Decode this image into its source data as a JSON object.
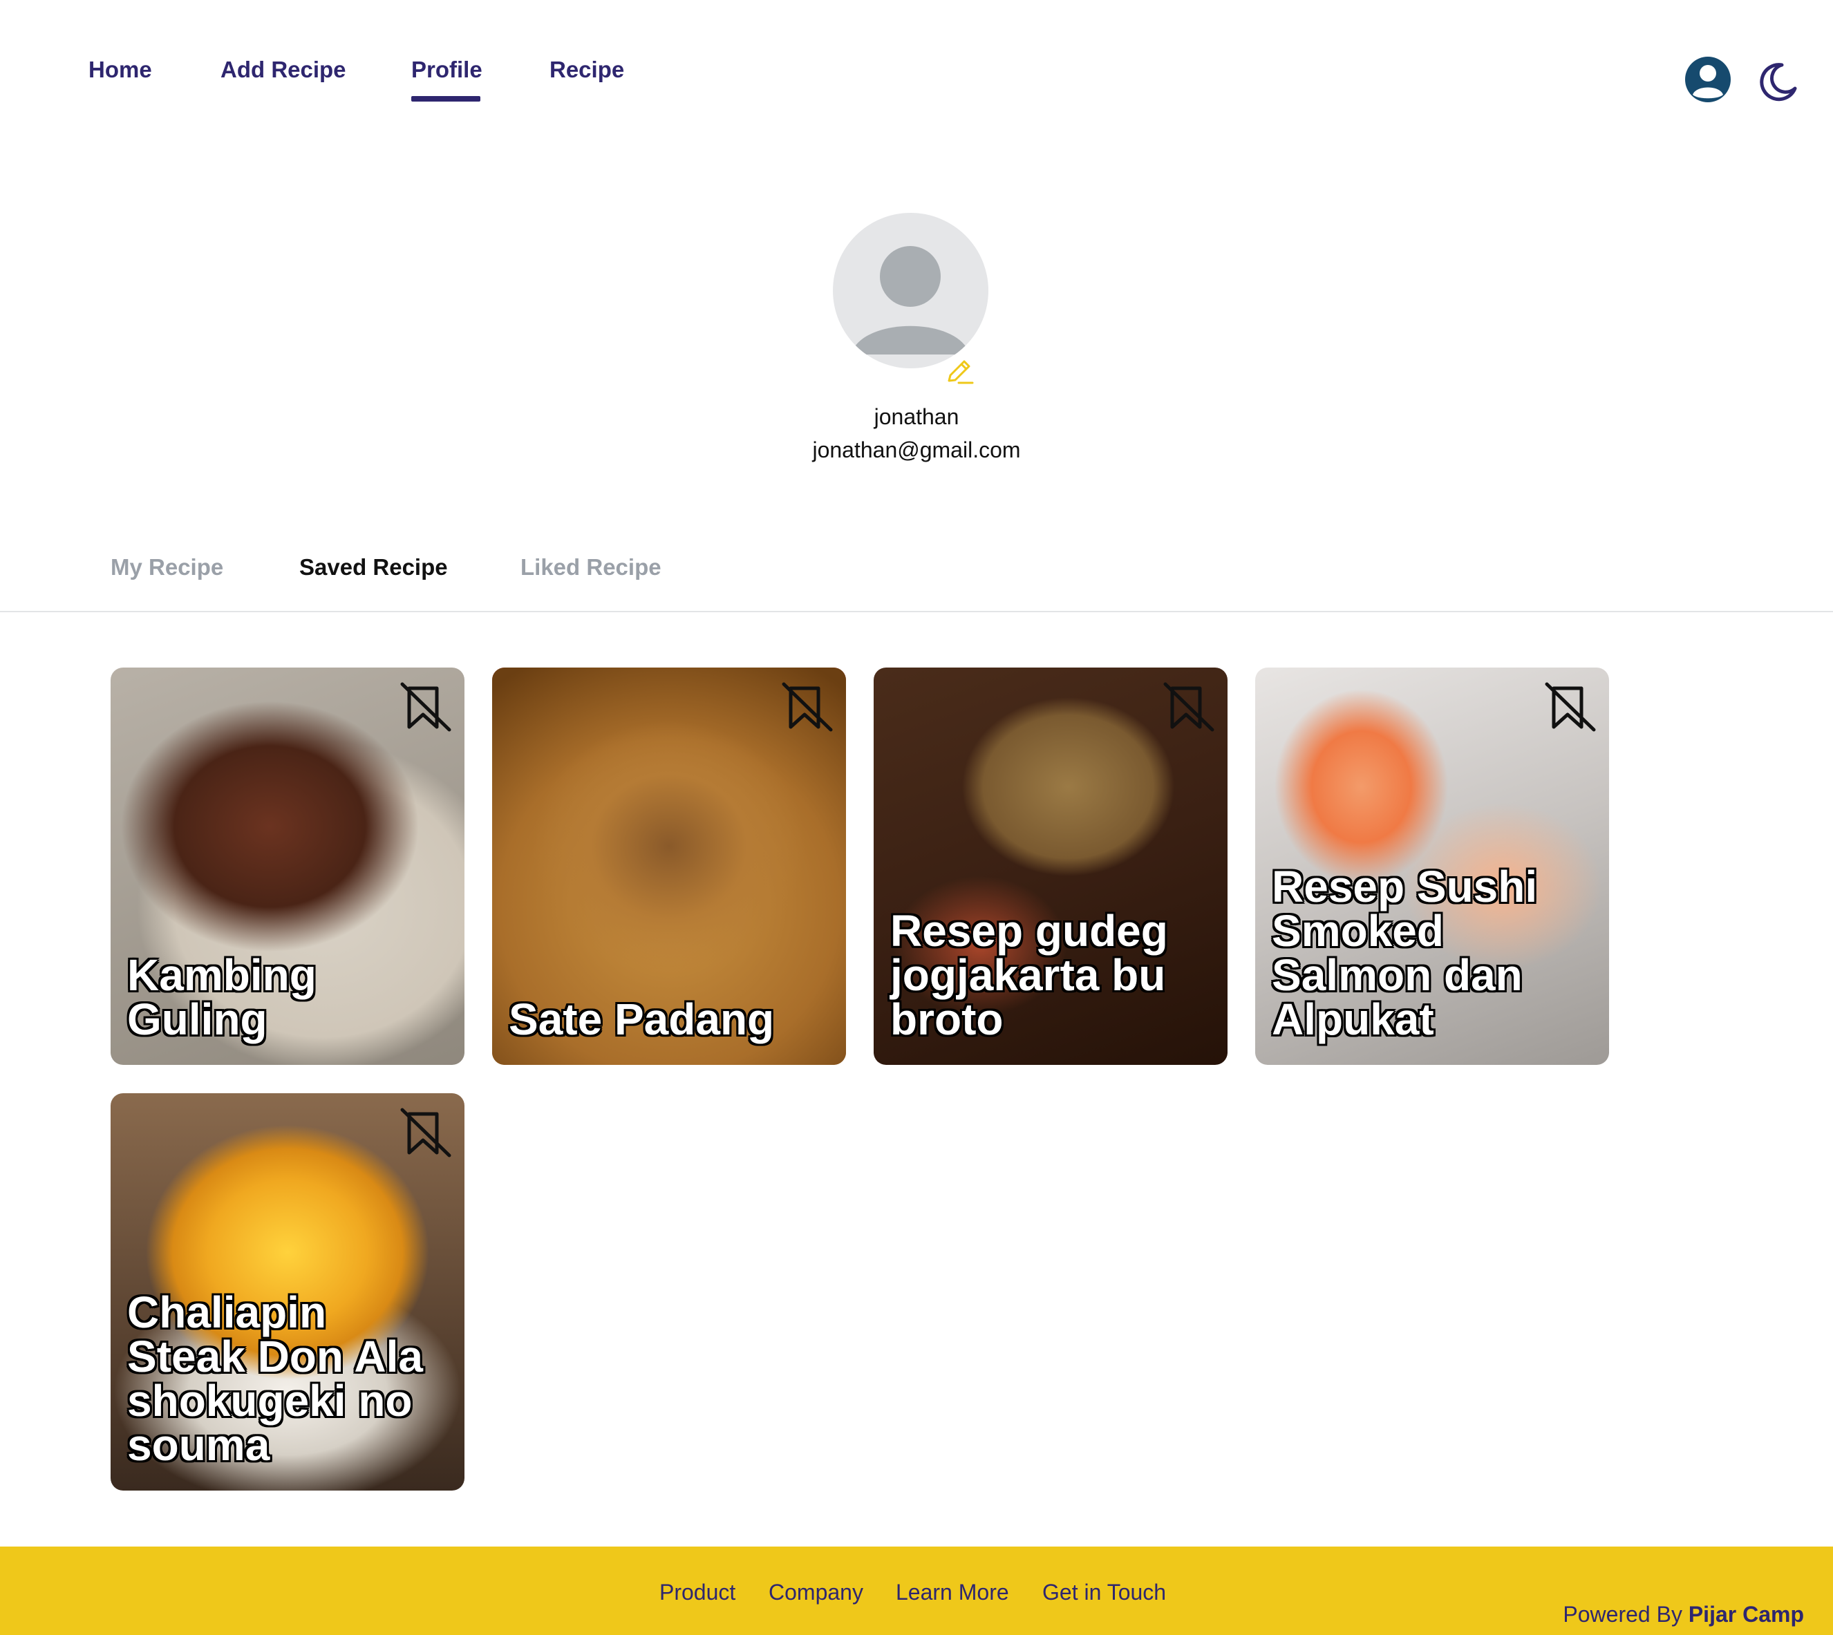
{
  "nav": {
    "links": [
      "Home",
      "Add Recipe",
      "Profile",
      "Recipe"
    ],
    "active": "Profile",
    "user_icon": "user-circle-icon",
    "theme_icon": "moon-icon"
  },
  "profile": {
    "name": "jonathan",
    "email": "jonathan@gmail.com",
    "avatar_icon": "default-avatar-icon",
    "edit_icon": "pencil-icon"
  },
  "tabs": {
    "items": [
      "My Recipe",
      "Saved Recipe",
      "Liked Recipe"
    ],
    "active": "Saved Recipe"
  },
  "recipes": [
    {
      "title": "Kambing Guling",
      "icon": "bookmark-remove-icon"
    },
    {
      "title": "Sate Padang",
      "icon": "bookmark-remove-icon"
    },
    {
      "title": "Resep gudeg jogjakarta bu broto",
      "icon": "bookmark-remove-icon"
    },
    {
      "title": "Resep Sushi Smoked Salmon dan Alpukat",
      "icon": "bookmark-remove-icon"
    },
    {
      "title": "Chaliapin Steak Don Ala shokugeki no souma",
      "icon": "bookmark-remove-icon"
    }
  ],
  "footer": {
    "links": [
      "Product",
      "Company",
      "Learn More",
      "Get in Touch"
    ],
    "powered_prefix": "Powered By",
    "powered_brand": "Pijar Camp"
  },
  "colors": {
    "primary": "#2e266f",
    "footer_bg": "#efc81a",
    "edit_accent": "#efc81a",
    "muted_tab": "#9aa0a8"
  }
}
